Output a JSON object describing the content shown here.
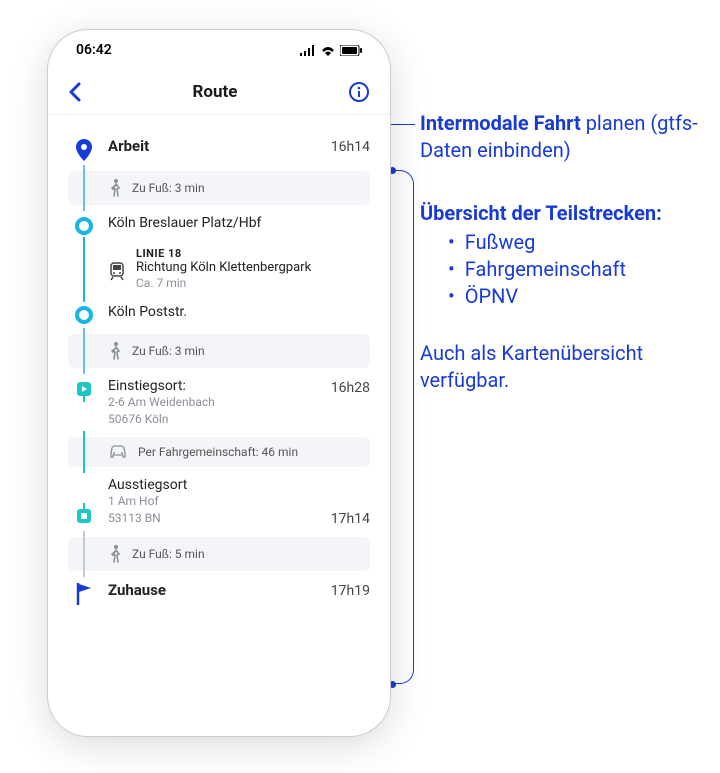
{
  "status_time": "06:42",
  "nav": {
    "title": "Route"
  },
  "route": {
    "start": {
      "label": "Arbeit",
      "time": "16h14"
    },
    "walk1": "Zu Fuß: 3 min",
    "stop1": "Köln Breslauer Platz/Hbf",
    "transit": {
      "line": "LINIE 18",
      "direction": "Richtung Köln Klettenbergpark",
      "duration": "Ca. 7 min"
    },
    "stop2": "Köln Poststr.",
    "walk2": "Zu Fuß: 3 min",
    "pickup": {
      "label": "Einstiegsort:",
      "addr1": "2-6 Am Weidenbach",
      "addr2": "50676 Köln",
      "time": "16h28"
    },
    "ride": "Per Fahrgemeinschaft: 46 min",
    "dropoff": {
      "label": "Ausstiegsort",
      "addr1": "1 Am Hof",
      "addr2": "53113 BN",
      "time": "17h14"
    },
    "walk3": "Zu Fuß: 5 min",
    "end": {
      "label": "Zuhause",
      "time": "17h19"
    }
  },
  "annotations": {
    "a1_bold": "Intermodale Fahrt",
    "a1_rest": "planen (gtfs-Daten einbinden)",
    "a2_bold": "Übersicht der Teilstrecken:",
    "a2_items": [
      "Fußweg",
      "Fahrgemeinschaft",
      "ÖPNV"
    ],
    "a3": "Auch als Karten­übersicht verfügbar."
  }
}
